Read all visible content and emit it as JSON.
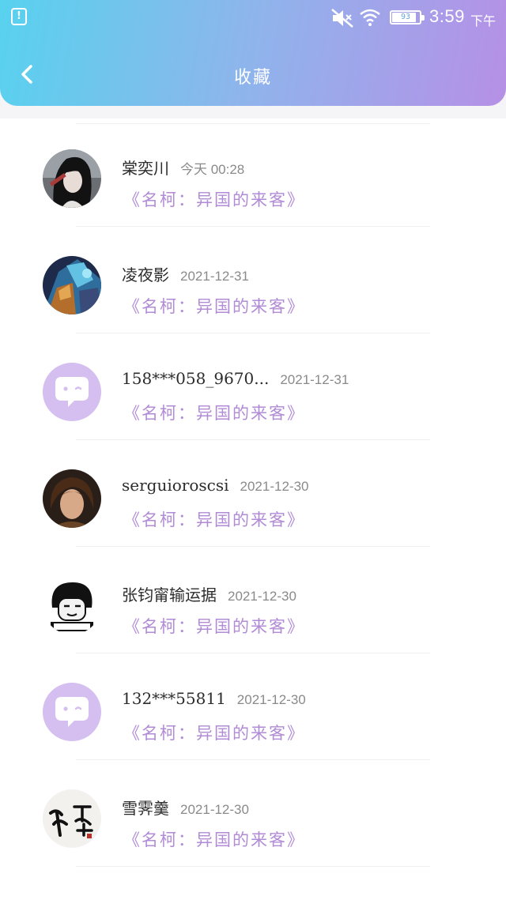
{
  "status_bar": {
    "alert_glyph": "!",
    "battery": "93",
    "time": "3:59",
    "ampm": "下午",
    "icons": [
      "alert-icon",
      "mute-icon",
      "wifi-icon",
      "battery-icon"
    ]
  },
  "header": {
    "title": "收藏",
    "back_icon": "chevron-left-icon"
  },
  "colors": {
    "gradient_start": "#58d2ee",
    "gradient_end": "#b690e6",
    "book_title": "#b18bd6",
    "default_avatar_bg": "#d4bff0"
  },
  "items": [
    {
      "name": "棠奕川",
      "time": "今天 00:28",
      "book": "《名柯：异国的来客》",
      "avatar": "photo-avatar-dark-hair"
    },
    {
      "name": "凌夜影",
      "time": "2021-12-31",
      "book": "《名柯：异国的来客》",
      "avatar": "photo-avatar-armor"
    },
    {
      "name": "158***058_9670...",
      "time": "2021-12-31",
      "book": "《名柯：异国的来客》",
      "avatar": "default-chat-avatar"
    },
    {
      "name": "serguioroscsi",
      "time": "2021-12-30",
      "book": "《名柯：异国的来客》",
      "avatar": "photo-avatar-portrait"
    },
    {
      "name": "张钧甯输运据",
      "time": "2021-12-30",
      "book": "《名柯：异国的来客》",
      "avatar": "meme-avatar"
    },
    {
      "name": "132***55811",
      "time": "2021-12-30",
      "book": "《名柯：异国的来客》",
      "avatar": "default-chat-avatar"
    },
    {
      "name": "雪霁羹",
      "time": "2021-12-30",
      "book": "《名柯：异国的来客》",
      "avatar": "calligraphy-avatar"
    }
  ]
}
